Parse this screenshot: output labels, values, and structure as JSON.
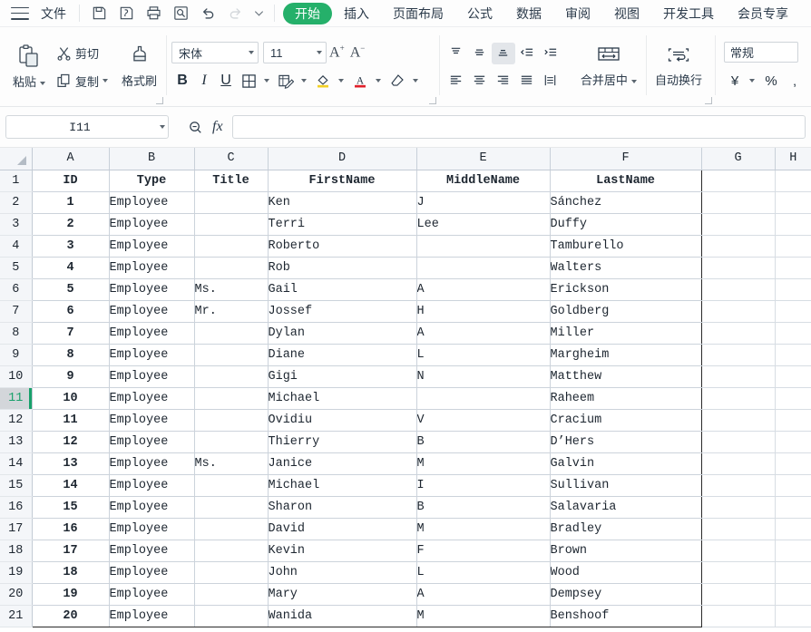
{
  "app": {
    "menu_file": "文件",
    "quick_access": [
      {
        "name": "save-icon",
        "label": "保存"
      },
      {
        "name": "save-as-icon",
        "label": "另存为"
      },
      {
        "name": "print-icon",
        "label": "打印"
      },
      {
        "name": "print-preview-icon",
        "label": "打印预览"
      },
      {
        "name": "undo-icon",
        "label": "撤销"
      },
      {
        "name": "redo-icon",
        "label": "恢复"
      },
      {
        "name": "customize-toolbar-icon",
        "label": "自定义快速访问工具栏"
      }
    ],
    "tabs": [
      {
        "label": "开始",
        "active": true
      },
      {
        "label": "插入",
        "active": false
      },
      {
        "label": "页面布局",
        "active": false
      },
      {
        "label": "公式",
        "active": false
      },
      {
        "label": "数据",
        "active": false
      },
      {
        "label": "审阅",
        "active": false
      },
      {
        "label": "视图",
        "active": false
      },
      {
        "label": "开发工具",
        "active": false
      },
      {
        "label": "会员专享",
        "active": false
      }
    ]
  },
  "ribbon": {
    "clipboard": {
      "paste": "粘贴",
      "cut": "剪切",
      "copy": "复制",
      "format_painter": "格式刷"
    },
    "font": {
      "family_value": "宋体",
      "size_value": "11",
      "grow_font": "A",
      "shrink_font": "A",
      "bold": "B",
      "italic": "I",
      "underline": "U"
    },
    "alignment": {
      "merge_center": "合并居中",
      "wrap_text": "自动换行"
    },
    "number": {
      "format_value": "常规",
      "currency": "¥",
      "percent": "%"
    }
  },
  "formula_bar": {
    "name_box_value": "I11",
    "formula_value": "",
    "fx_label": "fx"
  },
  "grid": {
    "columns": [
      {
        "letter": "A",
        "width": 85
      },
      {
        "letter": "B",
        "width": 94
      },
      {
        "letter": "C",
        "width": 81
      },
      {
        "letter": "D",
        "width": 164
      },
      {
        "letter": "E",
        "width": 147
      },
      {
        "letter": "F",
        "width": 167
      },
      {
        "letter": "G",
        "width": 81
      },
      {
        "letter": "H",
        "width": 40
      }
    ],
    "headers": [
      "ID",
      "Type",
      "Title",
      "FirstName",
      "MiddleName",
      "LastName"
    ],
    "selected_row": 11,
    "selected_cell": "I11",
    "rows": [
      {
        "n": 2,
        "id": "1",
        "type": "Employee",
        "title": "",
        "first": "Ken",
        "middle": "J",
        "last": "Sánchez"
      },
      {
        "n": 3,
        "id": "2",
        "type": "Employee",
        "title": "",
        "first": "Terri",
        "middle": "Lee",
        "last": "Duffy"
      },
      {
        "n": 4,
        "id": "3",
        "type": "Employee",
        "title": "",
        "first": "Roberto",
        "middle": "",
        "last": "Tamburello"
      },
      {
        "n": 5,
        "id": "4",
        "type": "Employee",
        "title": "",
        "first": "Rob",
        "middle": "",
        "last": "Walters"
      },
      {
        "n": 6,
        "id": "5",
        "type": "Employee",
        "title": "Ms.",
        "first": "Gail",
        "middle": "A",
        "last": "Erickson"
      },
      {
        "n": 7,
        "id": "6",
        "type": "Employee",
        "title": "Mr.",
        "first": "Jossef",
        "middle": "H",
        "last": "Goldberg"
      },
      {
        "n": 8,
        "id": "7",
        "type": "Employee",
        "title": "",
        "first": "Dylan",
        "middle": "A",
        "last": "Miller"
      },
      {
        "n": 9,
        "id": "8",
        "type": "Employee",
        "title": "",
        "first": "Diane",
        "middle": "L",
        "last": "Margheim"
      },
      {
        "n": 10,
        "id": "9",
        "type": "Employee",
        "title": "",
        "first": "Gigi",
        "middle": "N",
        "last": "Matthew"
      },
      {
        "n": 11,
        "id": "10",
        "type": "Employee",
        "title": "",
        "first": "Michael",
        "middle": "",
        "last": "Raheem"
      },
      {
        "n": 12,
        "id": "11",
        "type": "Employee",
        "title": "",
        "first": "Ovidiu",
        "middle": "V",
        "last": "Cracium"
      },
      {
        "n": 13,
        "id": "12",
        "type": "Employee",
        "title": "",
        "first": "Thierry",
        "middle": "B",
        "last": "D’Hers"
      },
      {
        "n": 14,
        "id": "13",
        "type": "Employee",
        "title": "Ms.",
        "first": "Janice",
        "middle": "M",
        "last": "Galvin"
      },
      {
        "n": 15,
        "id": "14",
        "type": "Employee",
        "title": "",
        "first": "Michael",
        "middle": "I",
        "last": "Sullivan"
      },
      {
        "n": 16,
        "id": "15",
        "type": "Employee",
        "title": "",
        "first": "Sharon",
        "middle": "B",
        "last": "Salavaria"
      },
      {
        "n": 17,
        "id": "16",
        "type": "Employee",
        "title": "",
        "first": "David",
        "middle": "M",
        "last": "Bradley"
      },
      {
        "n": 18,
        "id": "17",
        "type": "Employee",
        "title": "",
        "first": "Kevin",
        "middle": "F",
        "last": "Brown"
      },
      {
        "n": 19,
        "id": "18",
        "type": "Employee",
        "title": "",
        "first": "John",
        "middle": "L",
        "last": "Wood"
      },
      {
        "n": 20,
        "id": "19",
        "type": "Employee",
        "title": "",
        "first": "Mary",
        "middle": "A",
        "last": "Dempsey"
      },
      {
        "n": 21,
        "id": "20",
        "type": "Employee",
        "title": "",
        "first": "Wanida",
        "middle": "M",
        "last": "Benshoof"
      }
    ]
  },
  "colors": {
    "accent_green": "#25b06a",
    "header_bg": "#f4f6f9",
    "grid_line": "#ccd3db",
    "selected_row_bg": "#d3d6da",
    "selected_row_text": "#17a06a"
  }
}
